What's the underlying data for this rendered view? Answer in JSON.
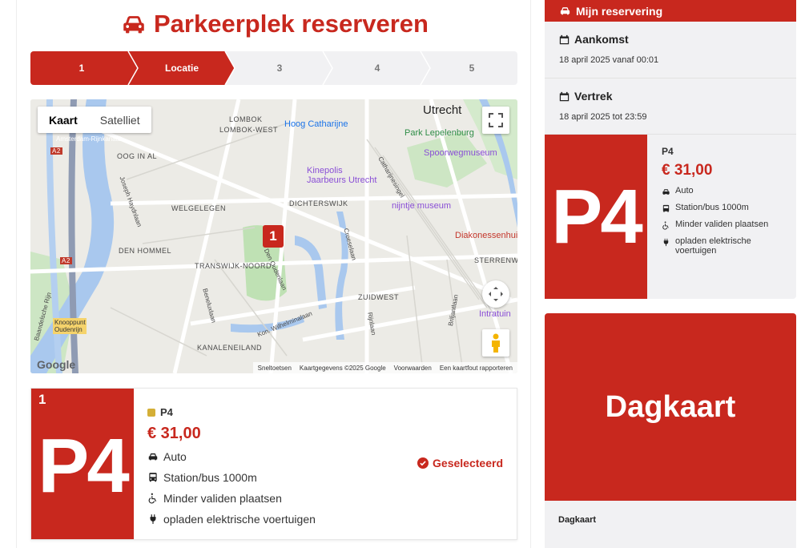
{
  "page": {
    "title": "Parkeerplek reserveren"
  },
  "stepper": {
    "steps": [
      {
        "label": "1",
        "active": true
      },
      {
        "label": "Locatie",
        "active": true
      },
      {
        "label": "3",
        "active": false
      },
      {
        "label": "4",
        "active": false
      },
      {
        "label": "5",
        "active": false
      }
    ]
  },
  "map": {
    "type_buttons": {
      "map": "Kaart",
      "satellite": "Satelliet"
    },
    "marker_label": "1",
    "labels": {
      "utrecht": "Utrecht",
      "lombok": "LOMBOK",
      "lombok_west": "LOMBOK-WEST",
      "hoog_catharijne": "Hoog Catharijne",
      "amsterdam_rijnkanaal": "Amsterdam-Rijnkanaal",
      "a2_top": "A2",
      "oog_in_al": "OOG IN AL",
      "joseph_haydnlaan": "Joseph Haydnlaan",
      "park_lepelenburg": "Park Lepelenburg",
      "spoorwegmuseum": "Spoorwegmuseum",
      "kinepolis": "Kinepolis",
      "jaarbeurs": "Jaarbeurs Utrecht",
      "catharijnesingel": "Catharijnesingel",
      "welgelegen": "WELGELEGEN",
      "dichterswijk": "DICHTERSWIJK",
      "nijntje": "nijntje museum",
      "den_hommel": "DEN HOMMEL",
      "croeselaan": "Croeselaan",
      "diakonessenhuis": "Diakonessenhuis",
      "a2_mid": "A2",
      "transwijk_noord": "TRANSWIJK-NOORD",
      "den_oudenlaan": "Den Oudenlaan",
      "sterrenwijk": "STERRENWIJK",
      "zuidwest": "ZUIDWEST",
      "benedenlaan": "Beneluxlaan",
      "kon_wilhelminalaan": "Kon. Wilhelminalaan",
      "rijnlaan": "Rijnlaan",
      "briljantlaan": "Briljantlaan",
      "intratuin": "Intratuin",
      "knooppunt": "Knooppunt Oudenrijn",
      "kanaleneiland": "KANALENEILAND",
      "baandelscheRijn": "Baandelsche Rijn"
    },
    "footer": {
      "shortcuts": "Sneltoetsen",
      "data": "Kaartgegevens ©2025 Google",
      "terms": "Voorwaarden",
      "report": "Een kaartfout rapporteren"
    },
    "logo": "Google"
  },
  "parking_card": {
    "number": "1",
    "badge": "P4",
    "name": "P4",
    "price": "€ 31,00",
    "features": [
      "Auto",
      "Station/bus 1000m",
      "Minder validen plaatsen",
      "opladen elektrische voertuigen"
    ],
    "status": "Geselecteerd"
  },
  "reservation": {
    "header": "Mijn reservering",
    "arrival_label": "Aankomst",
    "arrival_value": "18 april 2025 vanaf 00:01",
    "departure_label": "Vertrek",
    "departure_value": "18 april 2025 tot 23:59",
    "card": {
      "badge": "P4",
      "name": "P4",
      "price": "€ 31,00",
      "features": [
        "Auto",
        "Station/bus 1000m",
        "Minder validen plaatsen",
        "opladen elektrische voertuigen"
      ]
    },
    "ticket": {
      "badge": "Dagkaart",
      "label": "Dagkaart"
    }
  },
  "colors": {
    "brand": "#c8281e",
    "panel": "#f1f1f3",
    "marker_dot": "#d4af37"
  }
}
